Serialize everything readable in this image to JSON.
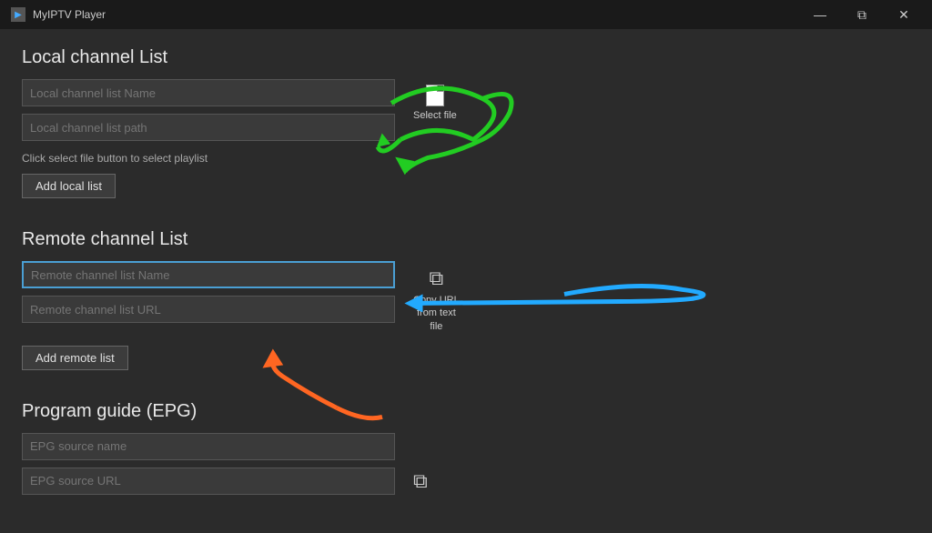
{
  "titleBar": {
    "icon": "▶",
    "title": "MyIPTV Player",
    "buttons": {
      "minimize": "—",
      "restore": "⧉",
      "close": "✕"
    }
  },
  "localSection": {
    "title": "Local channel List",
    "namePlaceholder": "Local channel list Name",
    "pathPlaceholder": "Local channel list path",
    "hintText": "Click select file button to select playlist",
    "addButton": "Add local list",
    "selectFileLabel": "Select file"
  },
  "remoteSection": {
    "title": "Remote channel List",
    "namePlaceholder": "Remote channel list Name",
    "urlPlaceholder": "Remote channel list URL",
    "addButton": "Add remote list",
    "copyLabel1": "Copy URL",
    "copyLabel2": "from text",
    "copyLabel3": "file"
  },
  "epgSection": {
    "title": "Program guide (EPG)",
    "namePlaceholder": "EPG source name",
    "urlPlaceholder": "EPG source URL"
  }
}
